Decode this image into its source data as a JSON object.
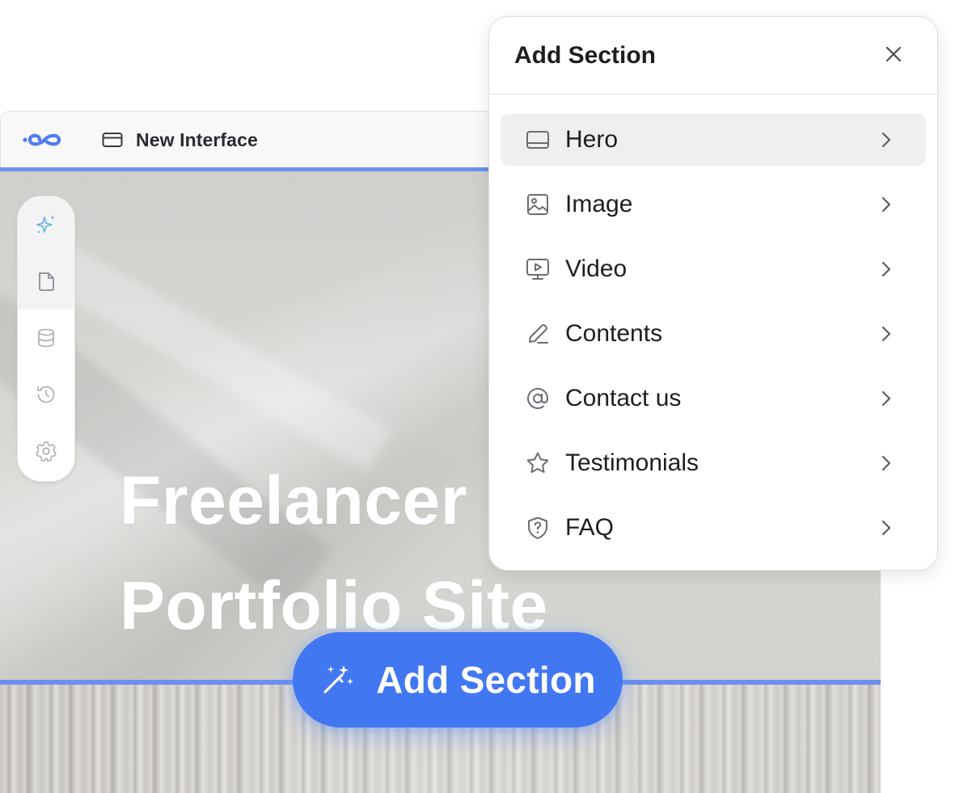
{
  "topbar": {
    "logo_icon": "infinity-logo-icon",
    "doc_icon": "browser-window-icon",
    "doc_title": "New Interface"
  },
  "side_toolbar": {
    "items": [
      {
        "icon": "sparkles-icon",
        "active": true
      },
      {
        "icon": "page-icon",
        "active": true
      },
      {
        "icon": "database-icon",
        "active": false
      },
      {
        "icon": "history-icon",
        "active": false
      },
      {
        "icon": "settings-gear-icon",
        "active": false
      }
    ]
  },
  "hero": {
    "title_line1": "Freelancer",
    "title_line2": "Portfolio Site"
  },
  "add_button": {
    "label": "Add Section",
    "icon": "magic-wand-icon"
  },
  "panel": {
    "title": "Add Section",
    "close_icon": "close-icon",
    "items": [
      {
        "label": "Hero",
        "icon": "hero-layout-icon",
        "selected": true
      },
      {
        "label": "Image",
        "icon": "image-icon",
        "selected": false
      },
      {
        "label": "Video",
        "icon": "video-icon",
        "selected": false
      },
      {
        "label": "Contents",
        "icon": "pencil-icon",
        "selected": false
      },
      {
        "label": "Contact us",
        "icon": "at-sign-icon",
        "selected": false
      },
      {
        "label": "Testimonials",
        "icon": "star-icon",
        "selected": false
      },
      {
        "label": "FAQ",
        "icon": "shield-question-icon",
        "selected": false
      }
    ]
  },
  "colors": {
    "accent": "#4277f2",
    "selection_line": "#6c8ff0",
    "text_dark": "#1d1e22",
    "icon_gray": "#6b6d73"
  }
}
